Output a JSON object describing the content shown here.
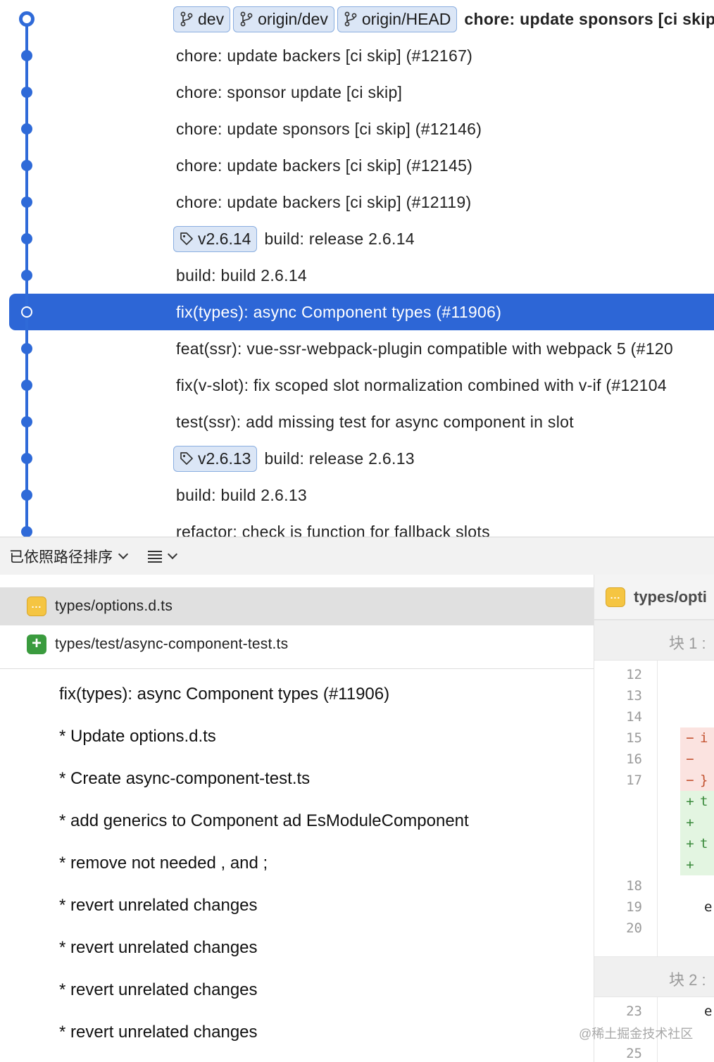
{
  "history": {
    "commits": [
      {
        "message": "chore: update sponsors [ci skip]",
        "refs": [
          {
            "type": "branch",
            "label": "dev"
          },
          {
            "type": "branch",
            "label": "origin/dev"
          },
          {
            "type": "branch",
            "label": "origin/HEAD"
          }
        ]
      },
      {
        "message": "chore: update backers [ci skip] (#12167)",
        "refs": []
      },
      {
        "message": "chore: sponsor update [ci skip]",
        "refs": []
      },
      {
        "message": "chore: update sponsors [ci skip] (#12146)",
        "refs": []
      },
      {
        "message": "chore: update backers [ci skip] (#12145)",
        "refs": []
      },
      {
        "message": "chore: update backers [ci skip] (#12119)",
        "refs": []
      },
      {
        "message": "build: release 2.6.14",
        "refs": [
          {
            "type": "tag",
            "label": "v2.6.14"
          }
        ]
      },
      {
        "message": "build: build 2.6.14",
        "refs": []
      },
      {
        "message": "fix(types): async Component types (#11906)",
        "refs": []
      },
      {
        "message": "feat(ssr): vue-ssr-webpack-plugin compatible with webpack 5 (#120",
        "refs": []
      },
      {
        "message": "fix(v-slot): fix scoped slot normalization combined with v-if (#12104",
        "refs": []
      },
      {
        "message": "test(ssr): add missing test for async component in slot",
        "refs": []
      },
      {
        "message": "build: release 2.6.13",
        "refs": [
          {
            "type": "tag",
            "label": "v2.6.13"
          }
        ]
      },
      {
        "message": "build: build 2.6.13",
        "refs": []
      },
      {
        "message": "refactor: check is function for fallback slots",
        "refs": []
      }
    ]
  },
  "toolbar": {
    "sort_label": "已依照路径排序"
  },
  "files": [
    {
      "name": "types/options.d.ts",
      "status": "modified"
    },
    {
      "name": "types/test/async-component-test.ts",
      "status": "added"
    }
  ],
  "commit_message": {
    "lines": [
      "fix(types): async Component types (#11906)",
      "* Update options.d.ts",
      "* Create async-component-test.ts",
      "* add generics to Component ad EsModuleComponent",
      "* remove not needed , and ;",
      "* revert unrelated changes",
      "* revert unrelated changes",
      "* revert unrelated changes",
      "* revert unrelated changes"
    ]
  },
  "diff": {
    "file_name": "types/opti",
    "hunks": [
      {
        "label": "块 1 :"
      },
      {
        "label": "块 2 :"
      }
    ],
    "line_numbers": [
      "12",
      "13",
      "14",
      "15",
      "16",
      "17",
      "18",
      "19",
      "20",
      "23",
      "25"
    ],
    "lines": [
      {
        "kind": "del",
        "sign": "−",
        "text": "i"
      },
      {
        "kind": "del",
        "sign": "−",
        "text": ""
      },
      {
        "kind": "del",
        "sign": "−",
        "text": "}"
      },
      {
        "kind": "ins",
        "sign": "+",
        "text": "t"
      },
      {
        "kind": "ins",
        "sign": "+",
        "text": ""
      },
      {
        "kind": "ins",
        "sign": "+",
        "text": "t"
      },
      {
        "kind": "ins",
        "sign": "+",
        "text": ""
      }
    ],
    "context": [
      "e",
      "e"
    ]
  },
  "watermark": "@稀土掘金技术社区",
  "colors": {
    "accent": "#2f6ad8",
    "selection": "#2d66d6",
    "badge_bg": "#dbe6f6",
    "modified_icon": "#f5c542",
    "added_icon": "#3a9b3e"
  }
}
